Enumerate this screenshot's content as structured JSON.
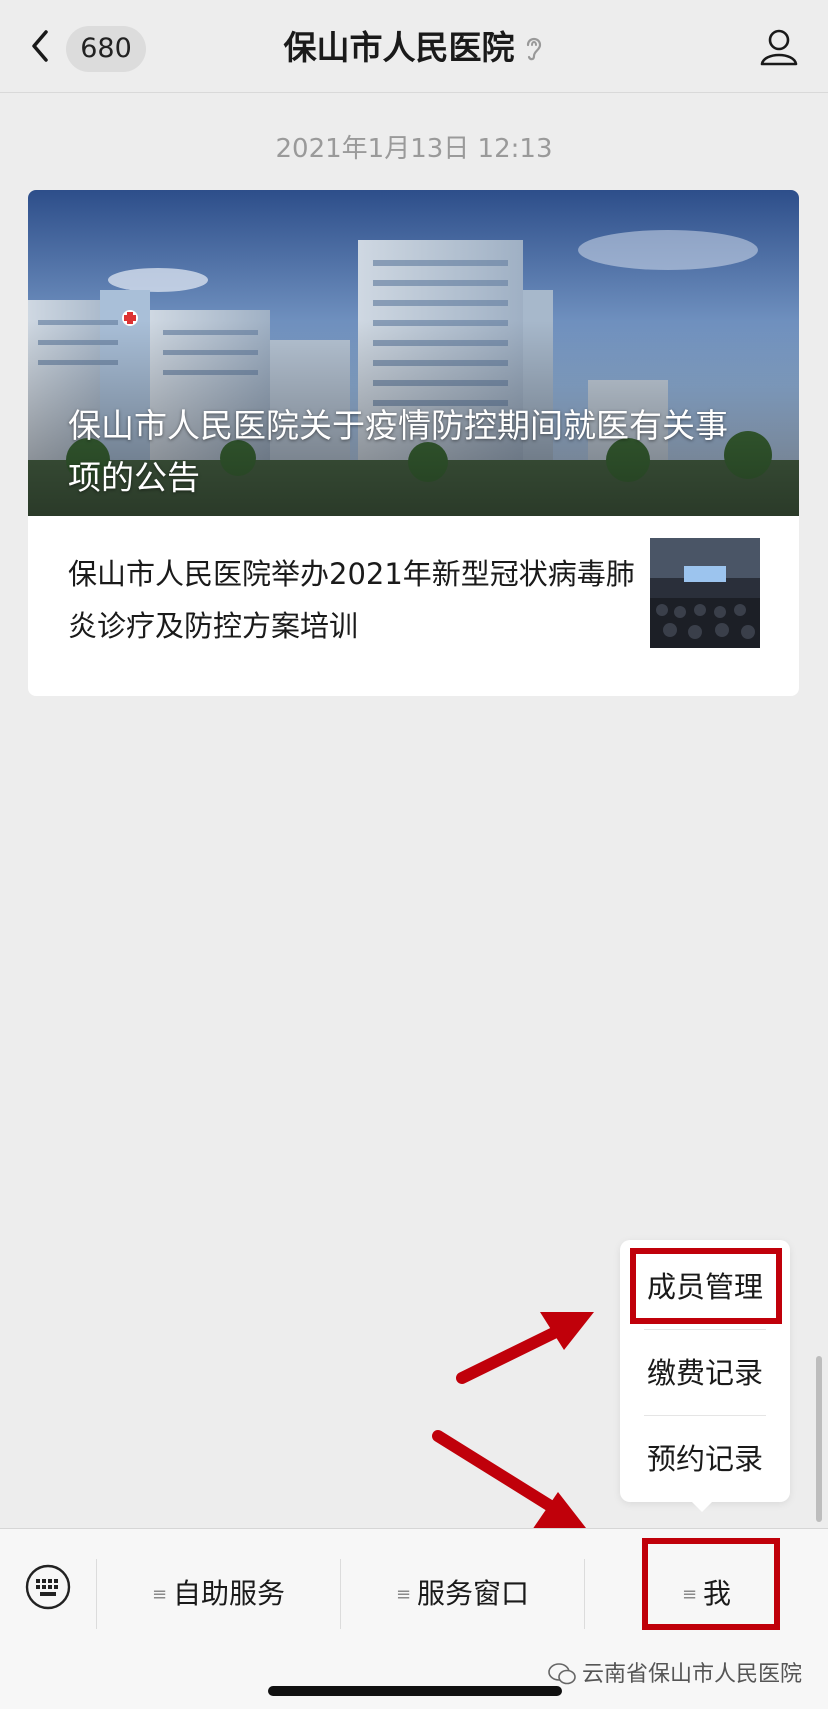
{
  "header": {
    "unread_count": "680",
    "title": "保山市人民医院"
  },
  "timestamp": "2021年1月13日 12:13",
  "article": {
    "cover_title": "保山市人民医院关于疫情防控期间就医有关事项的公告",
    "sub_title": "保山市人民医院举办2021年新型冠状病毒肺炎诊疗及防控方案培训"
  },
  "popup_menu": {
    "items": [
      {
        "label": "成员管理"
      },
      {
        "label": "缴费记录"
      },
      {
        "label": "预约记录"
      }
    ]
  },
  "bottom_menu": {
    "tabs": [
      {
        "label": "自助服务"
      },
      {
        "label": "服务窗口"
      },
      {
        "label": "我"
      }
    ]
  },
  "watermark": "云南省保山市人民医院",
  "colors": {
    "highlight": "#c0000a",
    "background": "#ededed"
  }
}
